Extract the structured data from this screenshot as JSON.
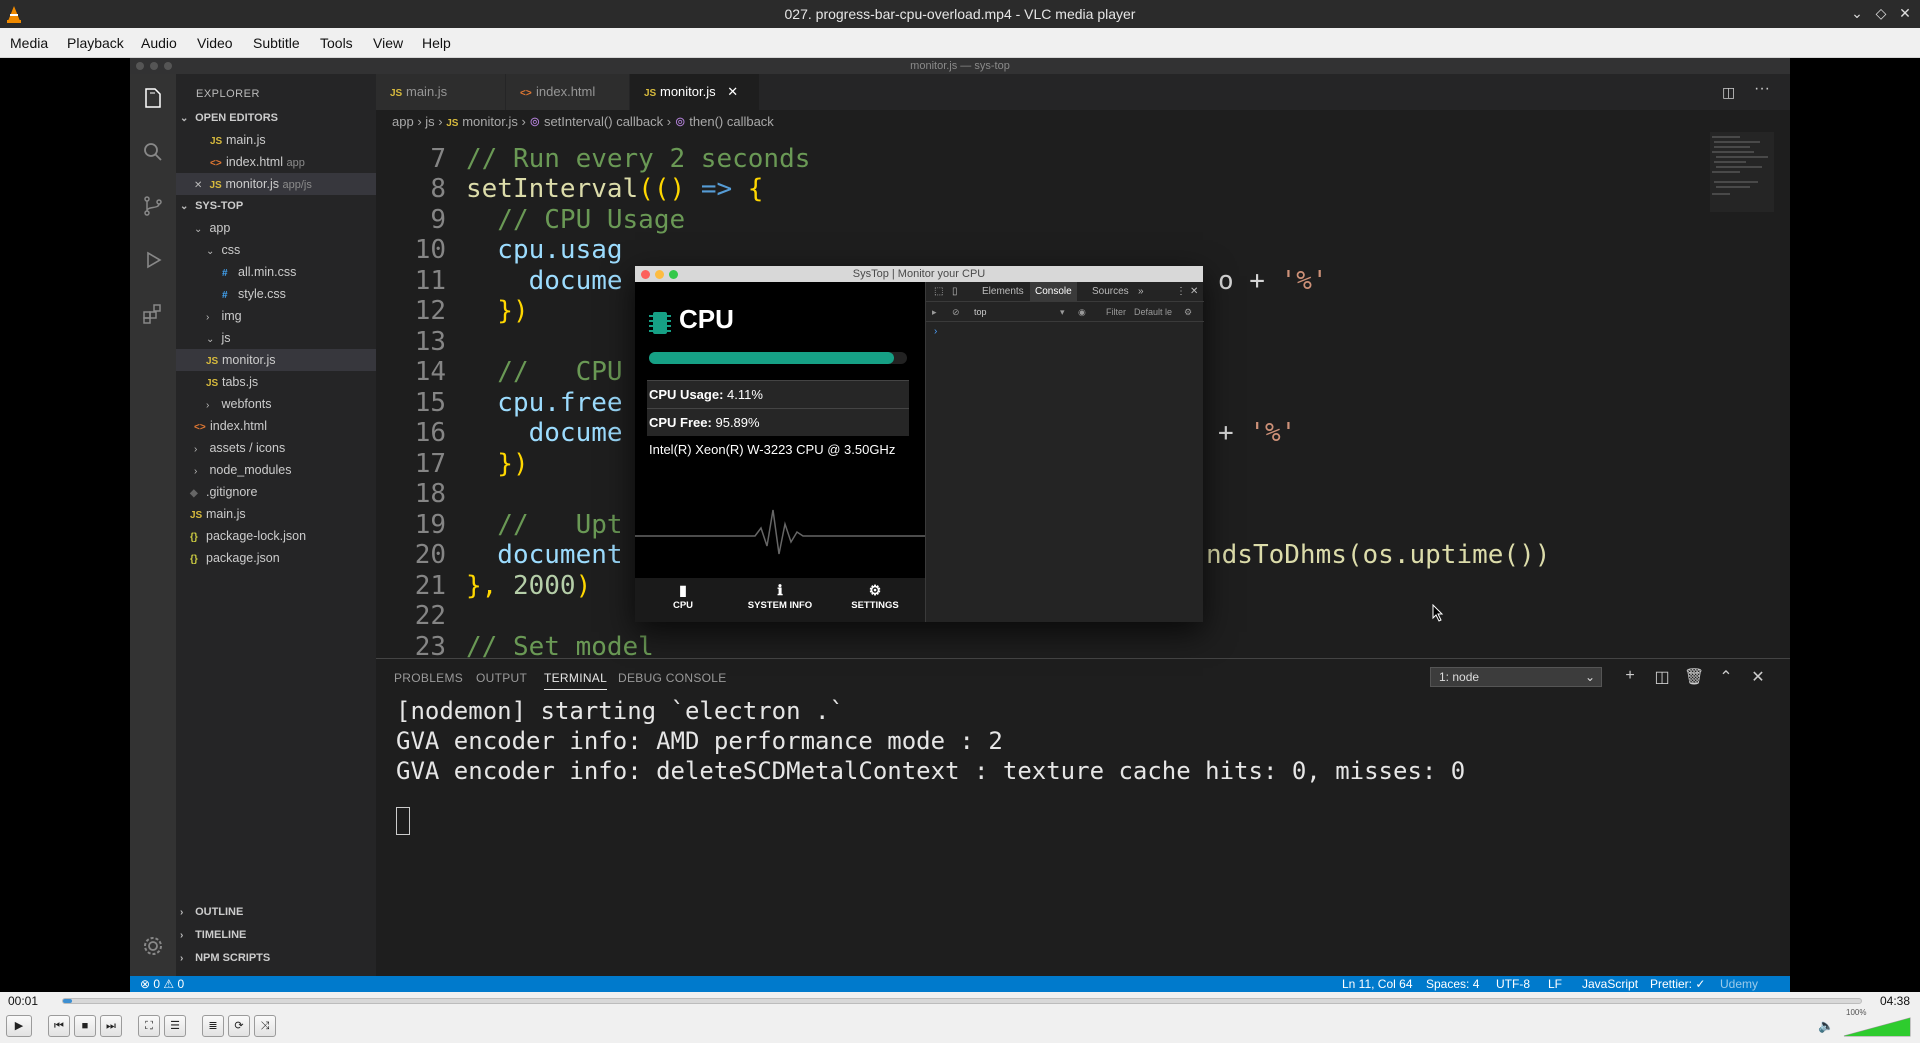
{
  "window": {
    "title": "027. progress-bar-cpu-overload.mp4 - VLC media player"
  },
  "menu": [
    "Media",
    "Playback",
    "Audio",
    "Video",
    "Subtitle",
    "Tools",
    "View",
    "Help"
  ],
  "vscode": {
    "window_title": "monitor.js — sys-top",
    "explorer_title": "EXPLORER",
    "open_editors_header": "OPEN EDITORS",
    "open_editors": [
      {
        "name": "main.js",
        "path": ""
      },
      {
        "name": "index.html",
        "path": "app"
      },
      {
        "name": "monitor.js",
        "path": "app/js"
      }
    ],
    "project_header": "SYS-TOP",
    "tree": {
      "app": "app",
      "css": "css",
      "all_min_css": "all.min.css",
      "style_css": "style.css",
      "img": "img",
      "js": "js",
      "monitor_js": "monitor.js",
      "tabs_js": "tabs.js",
      "webfonts": "webfonts",
      "index_html": "index.html",
      "assets_icons": "assets / icons",
      "node_modules": "node_modules",
      "gitignore": ".gitignore",
      "main_js": "main.js",
      "package_lock": "package-lock.json",
      "package_json": "package.json"
    },
    "bottom_sections": [
      "OUTLINE",
      "TIMELINE",
      "NPM SCRIPTS"
    ],
    "tabs": [
      "main.js",
      "index.html",
      "monitor.js"
    ],
    "breadcrumbs": [
      "app",
      "js",
      "monitor.js",
      "setInterval() callback",
      "then() callback"
    ],
    "code": {
      "line_numbers": [
        "7",
        "8",
        "9",
        "10",
        "11",
        "12",
        "13",
        "14",
        "15",
        "16",
        "17",
        "18",
        "19",
        "20",
        "21",
        "22",
        "23"
      ],
      "l7": "// Run every 2 seconds",
      "l8a": "setInterval",
      "l8b": "(() ",
      "l8c": "=>",
      "l8d": " {",
      "l9": "  // CPU Usage",
      "l10": "  cpu.usag",
      "l11a": "    docume",
      "l11b": "o + ",
      "l11c": "'%'",
      "l12": "  })",
      "l14": "  //   CPU",
      "l15": "  cpu.free",
      "l16a": "    docume",
      "l16b": "+ ",
      "l16c": "'%'",
      "l17": "  })",
      "l19": "  //   Upt",
      "l20a": "  document",
      "l20b": "ndsToDhms(os.uptime())",
      "l21a": "}, ",
      "l21b": "2000",
      "l21c": ")",
      "l23": "// Set model"
    },
    "panel_tabs": [
      "PROBLEMS",
      "OUTPUT",
      "TERMINAL",
      "DEBUG CONSOLE"
    ],
    "terminal_select": "1: node",
    "terminal_lines": [
      "[nodemon] starting `electron .`",
      "GVA encoder info: AMD performance mode : 2",
      "GVA encoder info: deleteSCDMetalContext : texture cache hits: 0, misses: 0"
    ],
    "status": {
      "problems": "⊗ 0 ⚠ 0",
      "position": "Ln 11, Col 64",
      "spaces": "Spaces: 4",
      "encoding": "UTF-8",
      "eol": "LF",
      "language": "JavaScript",
      "prettier": "Prettier: ✓",
      "watermark": "Udemy"
    }
  },
  "app": {
    "title": "SysTop | Monitor your CPU",
    "heading": "CPU",
    "progress_percent": 95,
    "cpu_usage_label": "CPU Usage:",
    "cpu_usage_value": "4.11%",
    "cpu_free_label": "CPU Free:",
    "cpu_free_value": "95.89%",
    "cpu_model": "Intel(R) Xeon(R) W-3223 CPU @ 3.50GHz",
    "nav": [
      "CPU",
      "SYSTEM INFO",
      "SETTINGS"
    ],
    "devtools_tabs": [
      "Elements",
      "Console",
      "Sources",
      "»"
    ],
    "devtools_context": "top",
    "devtools_filter": "Filter",
    "devtools_levels": "Default le"
  },
  "player": {
    "elapsed": "00:01",
    "total": "04:38",
    "progress_fraction": 0.004,
    "volume_label": "100%",
    "accent": "#3d8fd1"
  }
}
